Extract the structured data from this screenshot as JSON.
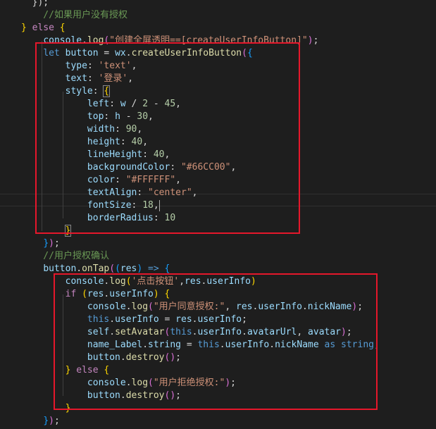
{
  "theme": {
    "background": "#1e1e1e",
    "annotation_color": "#e5172b"
  },
  "lines": [
    [
      {
        "t": "  });",
        "c": "plain"
      }
    ],
    [
      {
        "t": "    //如果用户没有授权",
        "c": "cmt"
      }
    ],
    [
      {
        "t": "} ",
        "c": "brk1"
      },
      {
        "t": "else",
        "c": "kw2"
      },
      {
        "t": " {",
        "c": "brk1"
      }
    ],
    [
      {
        "t": "    ",
        "c": "plain"
      },
      {
        "t": "console",
        "c": "var"
      },
      {
        "t": ".",
        "c": "plain"
      },
      {
        "t": "log",
        "c": "fn"
      },
      {
        "t": "(",
        "c": "brk2"
      },
      {
        "t": "\"创建全屏透明==[createUserInfoButton]\"",
        "c": "str"
      },
      {
        "t": ")",
        "c": "brk2"
      },
      {
        "t": ";",
        "c": "plain"
      }
    ],
    [
      {
        "t": "    ",
        "c": "plain"
      },
      {
        "t": "let",
        "c": "kw"
      },
      {
        "t": " ",
        "c": "plain"
      },
      {
        "t": "button",
        "c": "var"
      },
      {
        "t": " = ",
        "c": "plain"
      },
      {
        "t": "wx",
        "c": "var"
      },
      {
        "t": ".",
        "c": "plain"
      },
      {
        "t": "createUserInfoButton",
        "c": "fn"
      },
      {
        "t": "(",
        "c": "brk2"
      },
      {
        "t": "{",
        "c": "brk3"
      }
    ],
    [
      {
        "t": "        ",
        "c": "plain"
      },
      {
        "t": "type",
        "c": "prop"
      },
      {
        "t": ": ",
        "c": "plain"
      },
      {
        "t": "'text'",
        "c": "str"
      },
      {
        "t": ",",
        "c": "plain"
      }
    ],
    [
      {
        "t": "        ",
        "c": "plain"
      },
      {
        "t": "text",
        "c": "prop"
      },
      {
        "t": ": ",
        "c": "plain"
      },
      {
        "t": "'登录'",
        "c": "str"
      },
      {
        "t": ",",
        "c": "plain"
      }
    ],
    [
      {
        "t": "        ",
        "c": "plain"
      },
      {
        "t": "style",
        "c": "prop"
      },
      {
        "t": ": ",
        "c": "plain"
      },
      {
        "t": "{",
        "c": "brk1",
        "m": true
      }
    ],
    [
      {
        "t": "            ",
        "c": "plain"
      },
      {
        "t": "left",
        "c": "prop"
      },
      {
        "t": ": ",
        "c": "plain"
      },
      {
        "t": "w",
        "c": "var"
      },
      {
        "t": " / ",
        "c": "plain"
      },
      {
        "t": "2",
        "c": "num"
      },
      {
        "t": " - ",
        "c": "plain"
      },
      {
        "t": "45",
        "c": "num"
      },
      {
        "t": ",",
        "c": "plain"
      }
    ],
    [
      {
        "t": "            ",
        "c": "plain"
      },
      {
        "t": "top",
        "c": "prop"
      },
      {
        "t": ": ",
        "c": "plain"
      },
      {
        "t": "h",
        "c": "var"
      },
      {
        "t": " - ",
        "c": "plain"
      },
      {
        "t": "30",
        "c": "num"
      },
      {
        "t": ",",
        "c": "plain"
      }
    ],
    [
      {
        "t": "            ",
        "c": "plain"
      },
      {
        "t": "width",
        "c": "prop"
      },
      {
        "t": ": ",
        "c": "plain"
      },
      {
        "t": "90",
        "c": "num"
      },
      {
        "t": ",",
        "c": "plain"
      }
    ],
    [
      {
        "t": "            ",
        "c": "plain"
      },
      {
        "t": "height",
        "c": "prop"
      },
      {
        "t": ": ",
        "c": "plain"
      },
      {
        "t": "40",
        "c": "num"
      },
      {
        "t": ",",
        "c": "plain"
      }
    ],
    [
      {
        "t": "            ",
        "c": "plain"
      },
      {
        "t": "lineHeight",
        "c": "prop"
      },
      {
        "t": ": ",
        "c": "plain"
      },
      {
        "t": "40",
        "c": "num"
      },
      {
        "t": ",",
        "c": "plain"
      }
    ],
    [
      {
        "t": "            ",
        "c": "plain"
      },
      {
        "t": "backgroundColor",
        "c": "prop"
      },
      {
        "t": ": ",
        "c": "plain"
      },
      {
        "t": "\"#66CC00\"",
        "c": "str"
      },
      {
        "t": ",",
        "c": "plain"
      }
    ],
    [
      {
        "t": "            ",
        "c": "plain"
      },
      {
        "t": "color",
        "c": "prop"
      },
      {
        "t": ": ",
        "c": "plain"
      },
      {
        "t": "\"#FFFFFF\"",
        "c": "str"
      },
      {
        "t": ",",
        "c": "plain"
      }
    ],
    [
      {
        "t": "            ",
        "c": "plain"
      },
      {
        "t": "textAlign",
        "c": "prop"
      },
      {
        "t": ": ",
        "c": "plain"
      },
      {
        "t": "\"center\"",
        "c": "str"
      },
      {
        "t": ",",
        "c": "plain"
      }
    ],
    [
      {
        "t": "            ",
        "c": "plain"
      },
      {
        "t": "fontSize",
        "c": "prop"
      },
      {
        "t": ": ",
        "c": "plain"
      },
      {
        "t": "18",
        "c": "num"
      },
      {
        "t": ",",
        "c": "plain"
      },
      {
        "t": "",
        "c": "cursor"
      }
    ],
    [
      {
        "t": "            ",
        "c": "plain"
      },
      {
        "t": "borderRadius",
        "c": "prop"
      },
      {
        "t": ": ",
        "c": "plain"
      },
      {
        "t": "10",
        "c": "num"
      }
    ],
    [
      {
        "t": "        ",
        "c": "plain"
      },
      {
        "t": "}",
        "c": "brk1",
        "m": true
      }
    ],
    [
      {
        "t": "    ",
        "c": "plain"
      },
      {
        "t": "}",
        "c": "brk3"
      },
      {
        "t": ")",
        "c": "brk2"
      },
      {
        "t": ";",
        "c": "plain"
      }
    ],
    [
      {
        "t": "    //用户授权确认",
        "c": "cmt"
      }
    ],
    [
      {
        "t": "    ",
        "c": "plain"
      },
      {
        "t": "button",
        "c": "var"
      },
      {
        "t": ".",
        "c": "plain"
      },
      {
        "t": "onTap",
        "c": "fn"
      },
      {
        "t": "(",
        "c": "brk2"
      },
      {
        "t": "(",
        "c": "brk3"
      },
      {
        "t": "res",
        "c": "var"
      },
      {
        "t": ")",
        "c": "brk3"
      },
      {
        "t": " => ",
        "c": "kw"
      },
      {
        "t": "{",
        "c": "brk3"
      }
    ],
    [
      {
        "t": "        ",
        "c": "plain"
      },
      {
        "t": "console",
        "c": "var"
      },
      {
        "t": ".",
        "c": "plain"
      },
      {
        "t": "log",
        "c": "fn"
      },
      {
        "t": "(",
        "c": "brk1"
      },
      {
        "t": "'点击按钮'",
        "c": "str"
      },
      {
        "t": ",",
        "c": "plain"
      },
      {
        "t": "res",
        "c": "var"
      },
      {
        "t": ".",
        "c": "plain"
      },
      {
        "t": "userInfo",
        "c": "var"
      },
      {
        "t": ")",
        "c": "brk1"
      }
    ],
    [
      {
        "t": "        ",
        "c": "plain"
      },
      {
        "t": "if",
        "c": "kw2"
      },
      {
        "t": " ",
        "c": "plain"
      },
      {
        "t": "(",
        "c": "brk1"
      },
      {
        "t": "res",
        "c": "var"
      },
      {
        "t": ".",
        "c": "plain"
      },
      {
        "t": "userInfo",
        "c": "var"
      },
      {
        "t": ")",
        "c": "brk1"
      },
      {
        "t": " ",
        "c": "plain"
      },
      {
        "t": "{",
        "c": "brk1"
      }
    ],
    [
      {
        "t": "            ",
        "c": "plain"
      },
      {
        "t": "console",
        "c": "var"
      },
      {
        "t": ".",
        "c": "plain"
      },
      {
        "t": "log",
        "c": "fn"
      },
      {
        "t": "(",
        "c": "brk2"
      },
      {
        "t": "\"用户同意授权:\"",
        "c": "str"
      },
      {
        "t": ", ",
        "c": "plain"
      },
      {
        "t": "res",
        "c": "var"
      },
      {
        "t": ".",
        "c": "plain"
      },
      {
        "t": "userInfo",
        "c": "var"
      },
      {
        "t": ".",
        "c": "plain"
      },
      {
        "t": "nickName",
        "c": "var"
      },
      {
        "t": ")",
        "c": "brk2"
      },
      {
        "t": ";",
        "c": "plain"
      }
    ],
    [
      {
        "t": "            ",
        "c": "plain"
      },
      {
        "t": "this",
        "c": "kw"
      },
      {
        "t": ".",
        "c": "plain"
      },
      {
        "t": "userInfo",
        "c": "var"
      },
      {
        "t": " = ",
        "c": "plain"
      },
      {
        "t": "res",
        "c": "var"
      },
      {
        "t": ".",
        "c": "plain"
      },
      {
        "t": "userInfo",
        "c": "var"
      },
      {
        "t": ";",
        "c": "plain"
      }
    ],
    [
      {
        "t": "            ",
        "c": "plain"
      },
      {
        "t": "self",
        "c": "var"
      },
      {
        "t": ".",
        "c": "plain"
      },
      {
        "t": "setAvatar",
        "c": "fn"
      },
      {
        "t": "(",
        "c": "brk2"
      },
      {
        "t": "this",
        "c": "kw"
      },
      {
        "t": ".",
        "c": "plain"
      },
      {
        "t": "userInfo",
        "c": "var"
      },
      {
        "t": ".",
        "c": "plain"
      },
      {
        "t": "avatarUrl",
        "c": "var"
      },
      {
        "t": ", ",
        "c": "plain"
      },
      {
        "t": "avatar",
        "c": "var"
      },
      {
        "t": ")",
        "c": "brk2"
      },
      {
        "t": ";",
        "c": "plain"
      }
    ],
    [
      {
        "t": "            ",
        "c": "plain"
      },
      {
        "t": "name_Label",
        "c": "var"
      },
      {
        "t": ".",
        "c": "plain"
      },
      {
        "t": "string",
        "c": "var"
      },
      {
        "t": " = ",
        "c": "plain"
      },
      {
        "t": "this",
        "c": "kw"
      },
      {
        "t": ".",
        "c": "plain"
      },
      {
        "t": "userInfo",
        "c": "var"
      },
      {
        "t": ".",
        "c": "plain"
      },
      {
        "t": "nickName",
        "c": "var"
      },
      {
        "t": " ",
        "c": "plain"
      },
      {
        "t": "as",
        "c": "kw"
      },
      {
        "t": " ",
        "c": "plain"
      },
      {
        "t": "string",
        "c": "kw"
      },
      {
        "t": ";",
        "c": "plain"
      }
    ],
    [
      {
        "t": "            ",
        "c": "plain"
      },
      {
        "t": "button",
        "c": "var"
      },
      {
        "t": ".",
        "c": "plain"
      },
      {
        "t": "destroy",
        "c": "fn"
      },
      {
        "t": "(",
        "c": "brk2"
      },
      {
        "t": ")",
        "c": "brk2"
      },
      {
        "t": ";",
        "c": "plain"
      }
    ],
    [
      {
        "t": "        ",
        "c": "plain"
      },
      {
        "t": "}",
        "c": "brk1"
      },
      {
        "t": " ",
        "c": "plain"
      },
      {
        "t": "else",
        "c": "kw2"
      },
      {
        "t": " ",
        "c": "plain"
      },
      {
        "t": "{",
        "c": "brk1"
      }
    ],
    [
      {
        "t": "            ",
        "c": "plain"
      },
      {
        "t": "console",
        "c": "var"
      },
      {
        "t": ".",
        "c": "plain"
      },
      {
        "t": "log",
        "c": "fn"
      },
      {
        "t": "(",
        "c": "brk2"
      },
      {
        "t": "\"用户拒绝授权:\"",
        "c": "str"
      },
      {
        "t": ")",
        "c": "brk2"
      },
      {
        "t": ";",
        "c": "plain"
      }
    ],
    [
      {
        "t": "            ",
        "c": "plain"
      },
      {
        "t": "button",
        "c": "var"
      },
      {
        "t": ".",
        "c": "plain"
      },
      {
        "t": "destroy",
        "c": "fn"
      },
      {
        "t": "(",
        "c": "brk2"
      },
      {
        "t": ")",
        "c": "brk2"
      },
      {
        "t": ";",
        "c": "plain"
      }
    ],
    [
      {
        "t": "        ",
        "c": "plain"
      },
      {
        "t": "}",
        "c": "brk1"
      }
    ],
    [
      {
        "t": "    ",
        "c": "plain"
      },
      {
        "t": "}",
        "c": "brk3"
      },
      {
        "t": ")",
        "c": "brk2"
      },
      {
        "t": ";",
        "c": "plain"
      }
    ],
    [
      {
        "t": "}",
        "c": "brk1"
      }
    ]
  ]
}
